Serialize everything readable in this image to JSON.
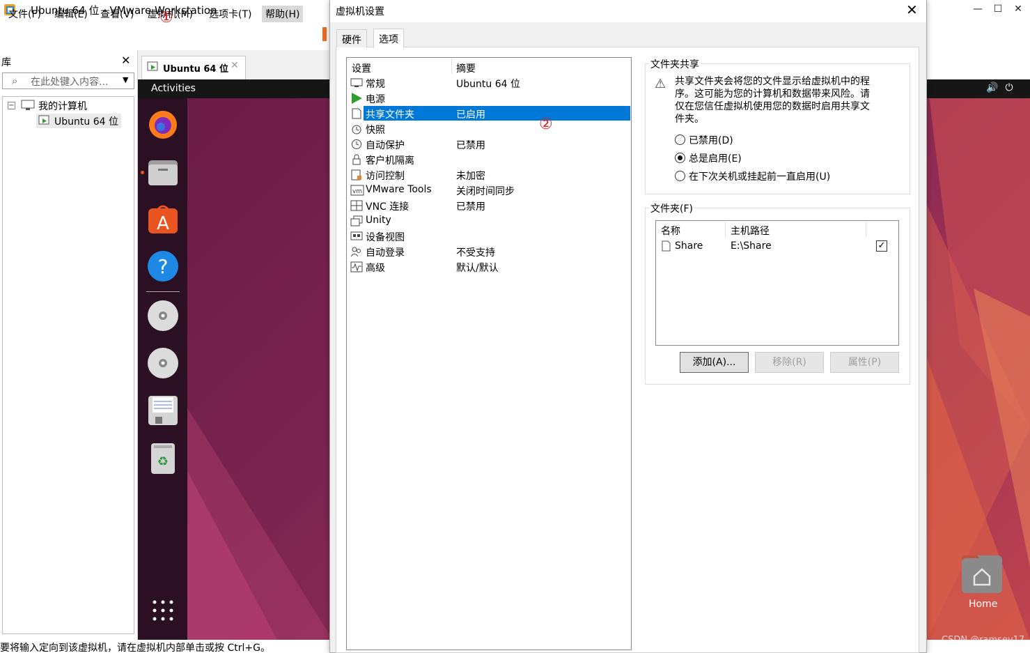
{
  "window": {
    "title": "Ubuntu 64 位 - VMware Workstation",
    "controls": [
      "—",
      "☐",
      "✕"
    ]
  },
  "menubar": {
    "items": [
      "文件(F)",
      "编辑(E)",
      "查看(V)",
      "虚拟机(M)",
      "选项卡(T)",
      "帮助(H)"
    ]
  },
  "library": {
    "title": "库",
    "close": "✕",
    "search_placeholder": "在此处键入内容...",
    "tree": {
      "root": "我的计算机",
      "vm": "Ubuntu 64 位"
    }
  },
  "vm_tab": {
    "label": "Ubuntu 64 位",
    "close": "✕"
  },
  "guest": {
    "activities": "Activities",
    "home_label": "Home",
    "watermark": "CSDN @ramsey17"
  },
  "statusbar": {
    "text": "要将输入定向到该虚拟机，请在虚拟机内部单击或按 Ctrl+G。"
  },
  "dialog": {
    "title": "虚拟机设置",
    "close": "✕",
    "tabs": [
      "硬件",
      "选项"
    ],
    "active_tab": "选项",
    "list_headers": {
      "setting": "设置",
      "summary": "摘要"
    },
    "settings": [
      {
        "name": "常规",
        "summary": "Ubuntu 64 位",
        "icon": "monitor-icon"
      },
      {
        "name": "电源",
        "summary": "",
        "icon": "play-icon"
      },
      {
        "name": "共享文件夹",
        "summary": "已启用",
        "icon": "shared-folder-icon"
      },
      {
        "name": "快照",
        "summary": "",
        "icon": "snapshot-icon"
      },
      {
        "name": "自动保护",
        "summary": "已禁用",
        "icon": "clock-icon"
      },
      {
        "name": "客户机隔离",
        "summary": "",
        "icon": "lock-icon"
      },
      {
        "name": "访问控制",
        "summary": "未加密",
        "icon": "access-icon"
      },
      {
        "name": "VMware Tools",
        "summary": "关闭时间同步",
        "icon": "vm-icon"
      },
      {
        "name": "VNC 连接",
        "summary": "已禁用",
        "icon": "vnc-icon"
      },
      {
        "name": "Unity",
        "summary": "",
        "icon": "unity-icon"
      },
      {
        "name": "设备视图",
        "summary": "",
        "icon": "device-view-icon"
      },
      {
        "name": "自动登录",
        "summary": "不受支持",
        "icon": "users-icon"
      },
      {
        "name": "高级",
        "summary": "默认/默认",
        "icon": "advanced-icon"
      }
    ],
    "selected_index": 2,
    "sharing": {
      "group_title": "文件夹共享",
      "warning": "共享文件夹会将您的文件显示给虚拟机中的程序。这可能为您的计算机和数据带来风险。请仅在您信任虚拟机使用您的数据时启用共享文件夹。",
      "options": [
        "已禁用(D)",
        "总是启用(E)",
        "在下次关机或挂起前一直启用(U)"
      ],
      "selected_option": "总是启用(E)"
    },
    "folders": {
      "group_title": "文件夹(F)",
      "headers": {
        "name": "名称",
        "path": "主机路径"
      },
      "rows": [
        {
          "name": "Share",
          "path": "E:\\Share",
          "checked": "☑"
        }
      ],
      "buttons": {
        "add": "添加(A)...",
        "remove": "移除(R)",
        "properties": "属性(P)"
      }
    }
  },
  "annotations": {
    "one": "①",
    "two": "②"
  },
  "colors": {
    "selection": "#0078d7",
    "annotation": "#e02020",
    "dock": "#2b0f22"
  }
}
